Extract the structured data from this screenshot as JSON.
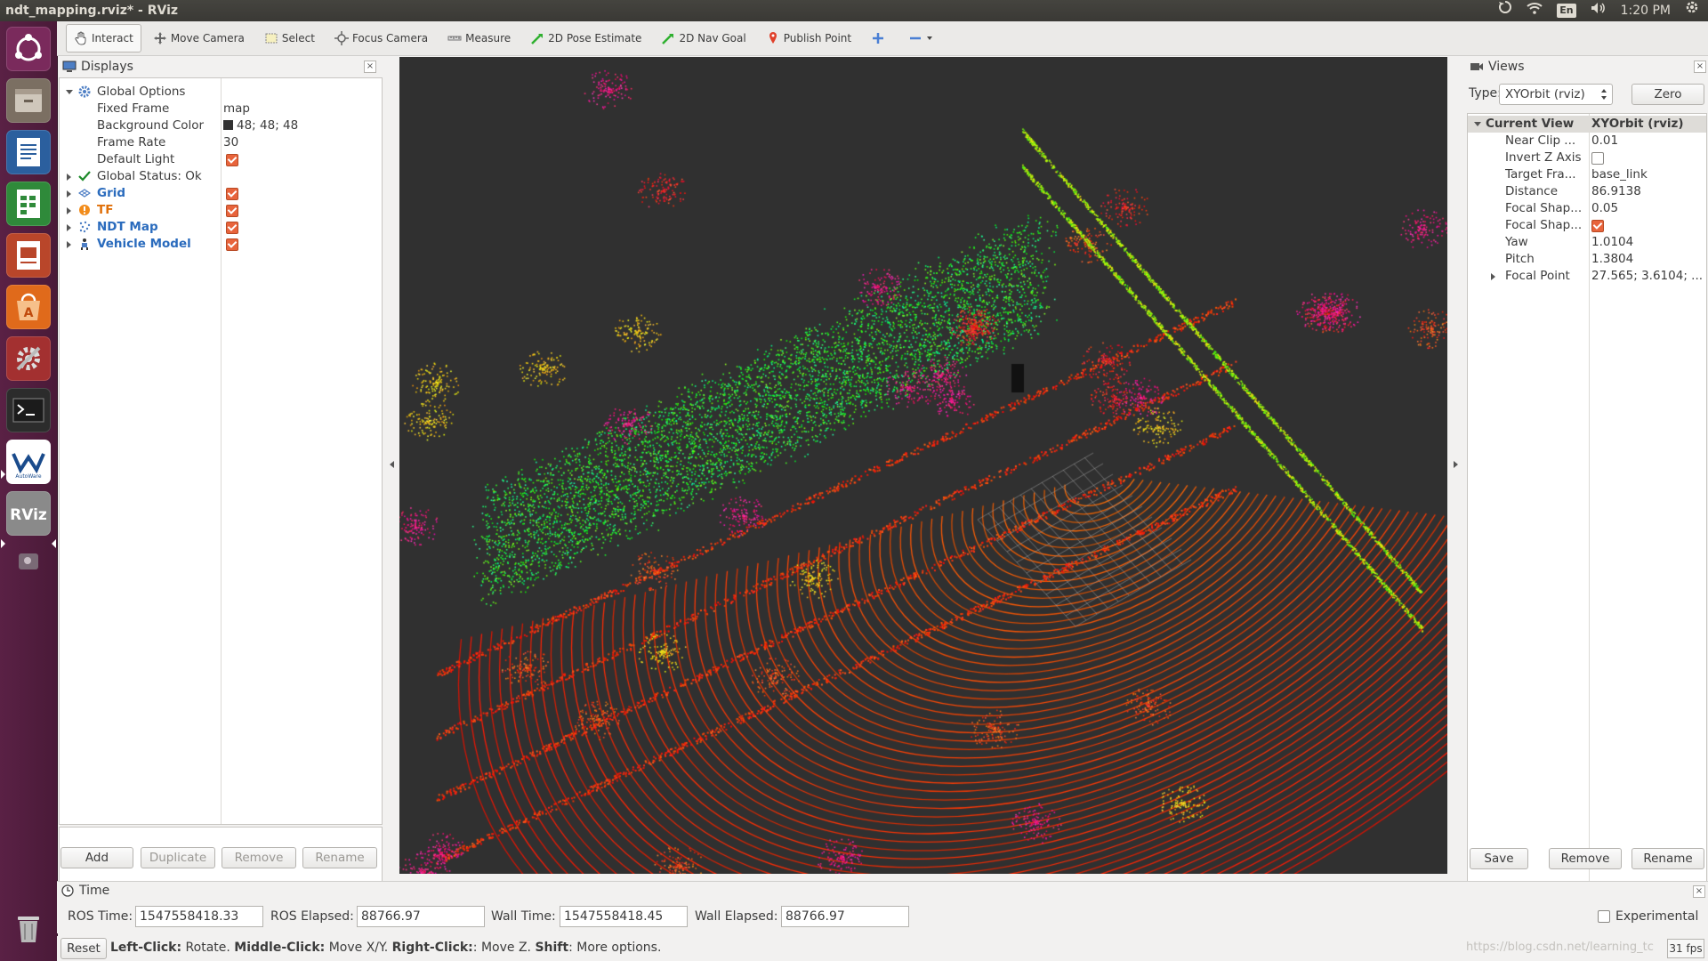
{
  "window": {
    "title": "ndt_mapping.rviz* - RViz"
  },
  "top_panel": {
    "keyboard": "En",
    "clock": "1:20 PM"
  },
  "launcher": {
    "icons": [
      "ubuntu-dash-icon",
      "files-icon",
      "writer-icon",
      "calc-icon",
      "impress-icon",
      "software-center-icon",
      "system-settings-icon",
      "terminal-icon",
      "autoware-icon",
      "rviz-icon",
      "screenshot-icon",
      "trash-icon"
    ],
    "labels": {
      "autoware": "AutoWare",
      "rviz": "RViz"
    }
  },
  "toolbar": {
    "tools": [
      {
        "label": "Interact",
        "icon": "hand-icon",
        "active": true
      },
      {
        "label": "Move Camera",
        "icon": "move-camera-icon",
        "active": false
      },
      {
        "label": "Select",
        "icon": "select-icon",
        "active": false
      },
      {
        "label": "Focus Camera",
        "icon": "focus-camera-icon",
        "active": false
      },
      {
        "label": "Measure",
        "icon": "ruler-icon",
        "active": false
      },
      {
        "label": "2D Pose Estimate",
        "icon": "pose-arrow-icon",
        "active": false
      },
      {
        "label": "2D Nav Goal",
        "icon": "nav-arrow-icon",
        "active": false
      },
      {
        "label": "Publish Point",
        "icon": "map-pin-icon",
        "active": false
      }
    ]
  },
  "displays": {
    "title": "Displays",
    "global_options": {
      "label": "Global Options",
      "fixed_frame": {
        "label": "Fixed Frame",
        "value": "map"
      },
      "background_color": {
        "label": "Background Color",
        "value": "48; 48; 48",
        "color": "#303030"
      },
      "frame_rate": {
        "label": "Frame Rate",
        "value": "30"
      },
      "default_light": {
        "label": "Default Light",
        "checked": true
      }
    },
    "global_status": "Global Status: Ok",
    "items": [
      {
        "label": "Grid",
        "checked": true,
        "color": "#2a6bbd"
      },
      {
        "label": "TF",
        "checked": true,
        "color": "#e0700a"
      },
      {
        "label": "NDT Map",
        "checked": true,
        "color": "#2a6bbd"
      },
      {
        "label": "Vehicle Model",
        "checked": true,
        "color": "#2a6bbd"
      }
    ],
    "buttons": {
      "add": "Add",
      "duplicate": "Duplicate",
      "remove": "Remove",
      "rename": "Rename"
    }
  },
  "views": {
    "title": "Views",
    "type_label": "Type:",
    "type_value": "XYOrbit (rviz)",
    "zero": "Zero",
    "current_view": {
      "label": "Current View",
      "value": "XYOrbit (rviz)"
    },
    "properties": [
      {
        "label": "Near Clip ...",
        "value": "0.01"
      },
      {
        "label": "Invert Z Axis",
        "value": "",
        "checkbox": "empty"
      },
      {
        "label": "Target Fra...",
        "value": "base_link"
      },
      {
        "label": "Distance",
        "value": "86.9138"
      },
      {
        "label": "Focal Shap...",
        "value": "0.05"
      },
      {
        "label": "Focal Shap...",
        "value": "",
        "checkbox": "checked"
      },
      {
        "label": "Yaw",
        "value": "1.0104"
      },
      {
        "label": "Pitch",
        "value": "1.3804"
      },
      {
        "label": "Focal Point",
        "value": "27.565; 3.6104; ...",
        "expandable": true
      }
    ],
    "buttons": {
      "save": "Save",
      "remove": "Remove",
      "rename": "Rename"
    }
  },
  "time": {
    "title": "Time",
    "ros_time": {
      "label": "ROS Time:",
      "value": "1547558418.33"
    },
    "ros_elapsed": {
      "label": "ROS Elapsed:",
      "value": "88766.97"
    },
    "wall_time": {
      "label": "Wall Time:",
      "value": "1547558418.45"
    },
    "wall_elapsed": {
      "label": "Wall Elapsed:",
      "value": "88766.97"
    },
    "experimental": "Experimental"
  },
  "status": {
    "reset": "Reset",
    "hint_parts": [
      {
        "text": "Left-Click:",
        "bold": true
      },
      {
        "text": " Rotate. ",
        "bold": false
      },
      {
        "text": "Middle-Click:",
        "bold": true
      },
      {
        "text": " Move X/Y. ",
        "bold": false
      },
      {
        "text": "Right-Click:",
        "bold": true
      },
      {
        "text": ": Move Z. ",
        "bold": false
      },
      {
        "text": "Shift",
        "bold": true
      },
      {
        "text": ": More options.",
        "bold": false
      }
    ],
    "watermark": "https://blog.csdn.net/learning_tc",
    "fps": "31 fps"
  }
}
